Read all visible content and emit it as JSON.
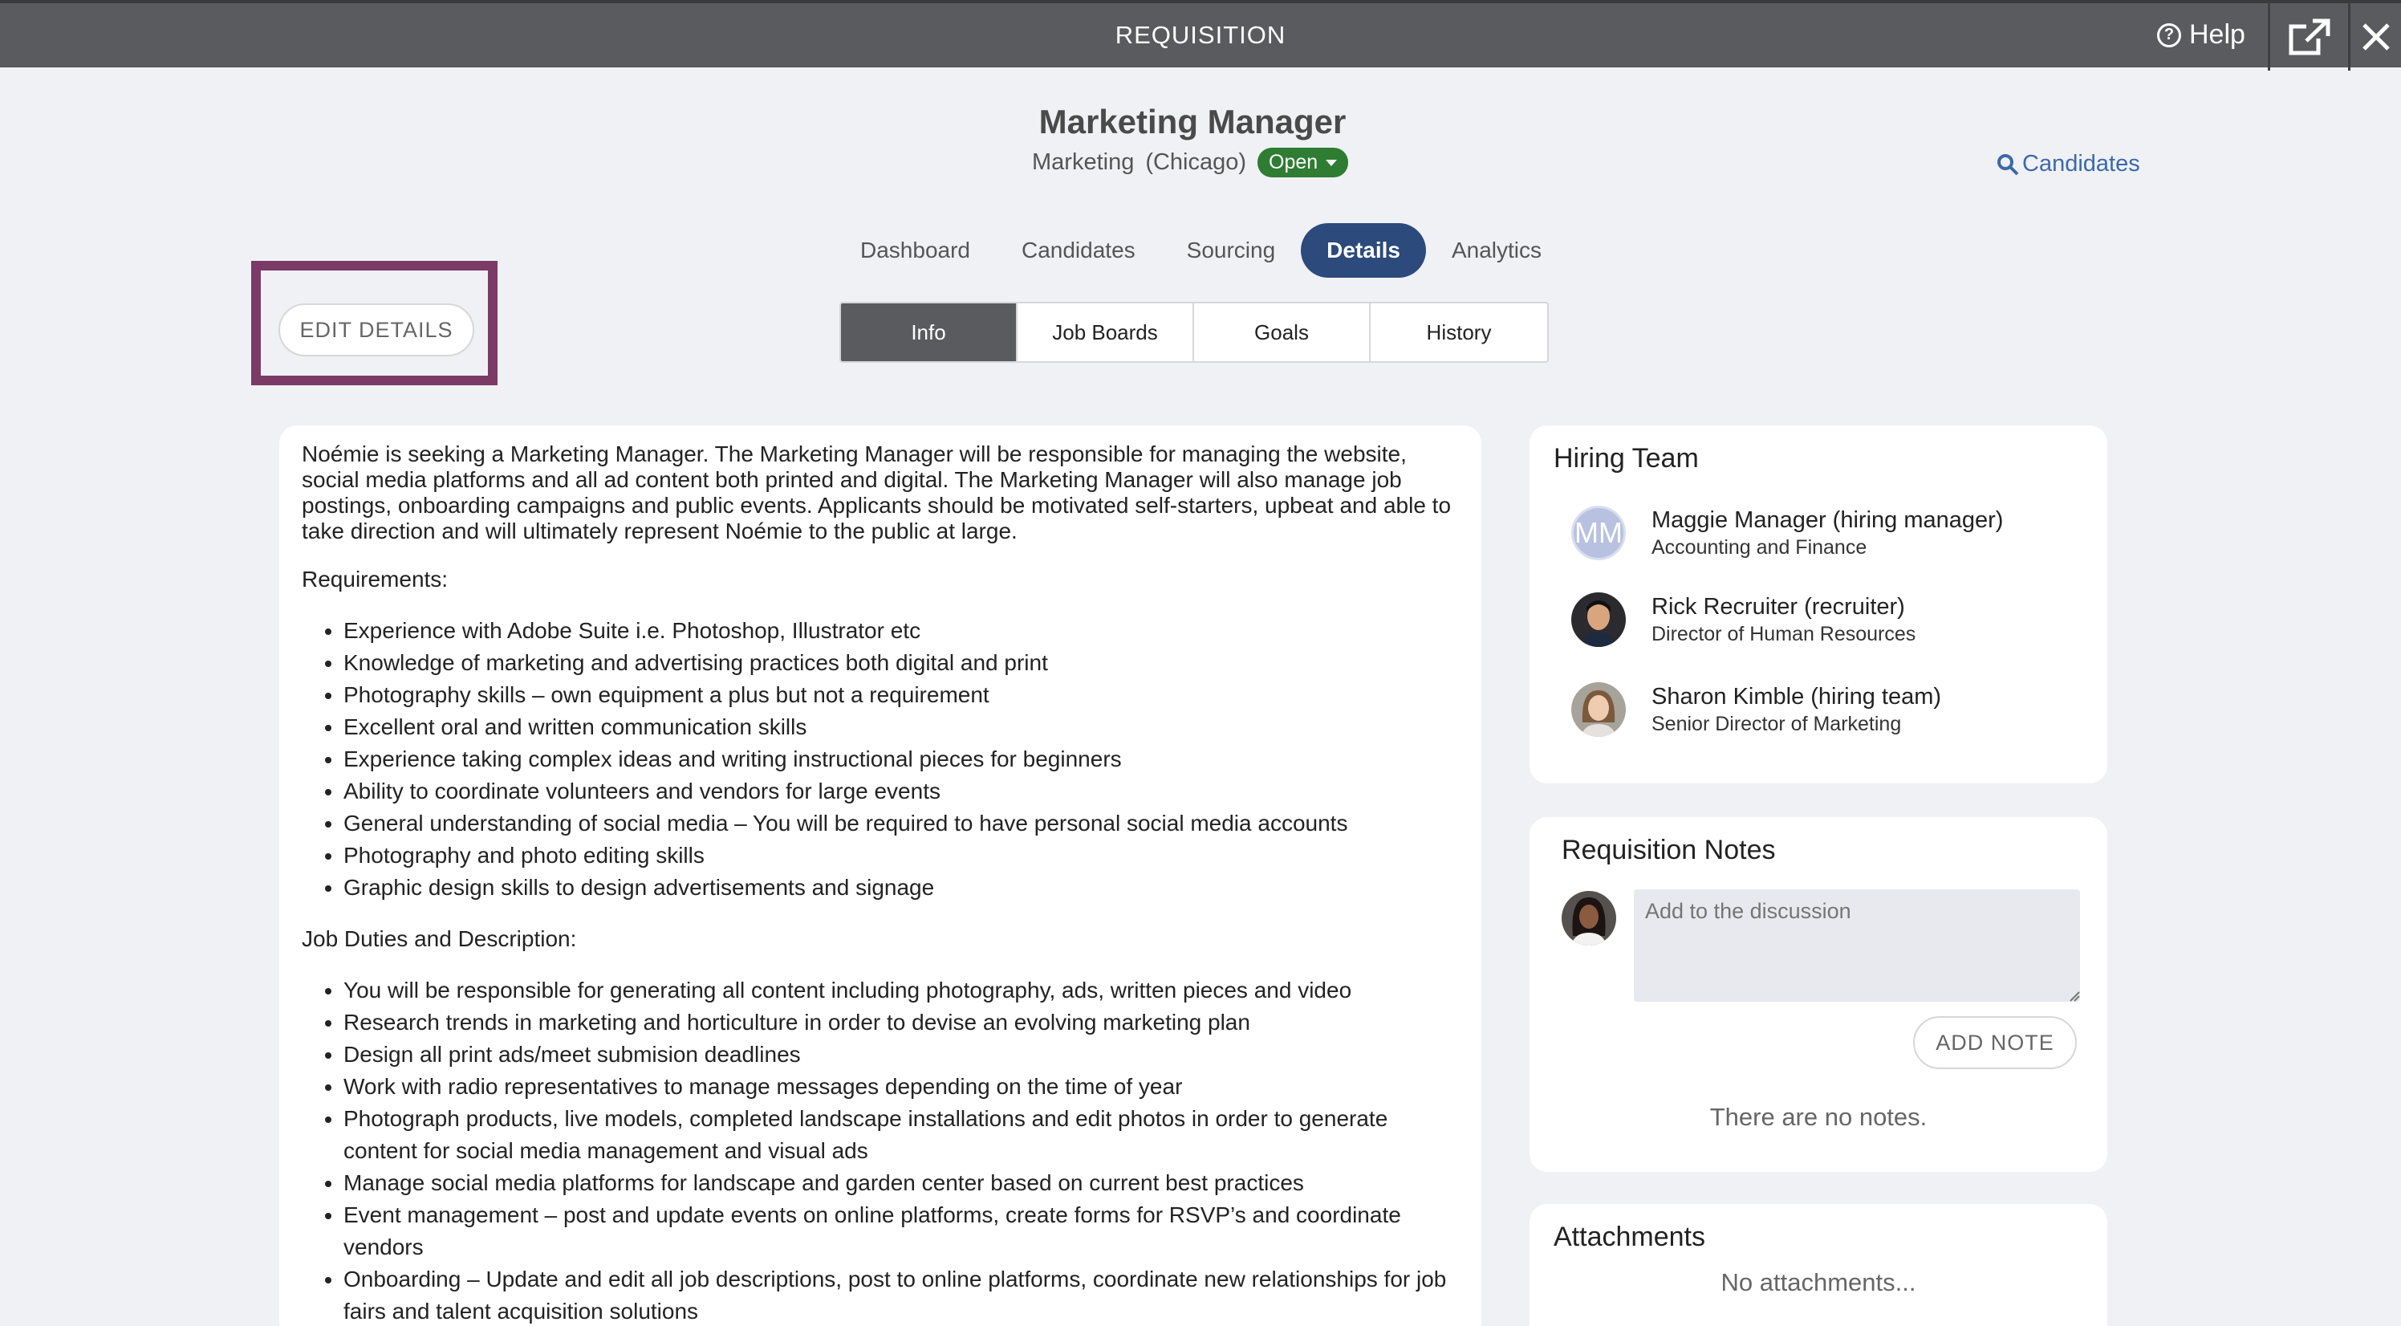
{
  "window": {
    "title": "REQUISITION",
    "help_label": "Help",
    "icons": [
      "help-circle-icon",
      "external-link-icon",
      "close-icon"
    ]
  },
  "header": {
    "job_title": "Marketing Manager",
    "department": "Marketing",
    "location": "(Chicago)",
    "status": "Open",
    "candidates_link": "Candidates"
  },
  "main_tabs": [
    {
      "label": "Dashboard",
      "active": false
    },
    {
      "label": "Candidates",
      "active": false
    },
    {
      "label": "Sourcing",
      "active": false
    },
    {
      "label": "Details",
      "active": true
    },
    {
      "label": "Analytics",
      "active": false
    }
  ],
  "sub_tabs": [
    {
      "label": "Info",
      "active": true
    },
    {
      "label": "Job Boards",
      "active": false
    },
    {
      "label": "Goals",
      "active": false
    },
    {
      "label": "History",
      "active": false
    }
  ],
  "edit_details_label": "EDIT DETAILS",
  "description": {
    "intro": "Noémie is seeking a Marketing Manager. The Marketing Manager will be responsible for managing the website, social media platforms and all ad content both printed and digital. The Marketing Manager will also manage job postings, onboarding campaigns and public events. Applicants should be motivated self-starters, upbeat and able to take direction and will ultimately represent Noémie to the public at large.",
    "requirements_label": "Requirements:",
    "requirements": [
      "Experience with Adobe Suite i.e. Photoshop, Illustrator etc",
      "Knowledge of marketing and advertising practices both digital and print",
      "Photography skills – own equipment a plus but not a requirement",
      "Excellent oral and written communication skills",
      "Experience taking complex ideas and writing instructional pieces for beginners",
      "Ability to coordinate volunteers and vendors for large events",
      "General understanding of social media – You will be required to have personal social media accounts",
      "Photography and photo editing skills",
      "Graphic design skills to design advertisements and signage"
    ],
    "duties_label": "Job Duties and Description:",
    "duties": [
      "You will be responsible for generating all content including photography, ads, written pieces and video",
      "Research trends in marketing and horticulture in order to devise an evolving marketing plan",
      "Design all print ads/meet submision deadlines",
      "Work with radio representatives to manage messages depending on the time of year",
      "Photograph products, live models, completed landscape installations and edit photos in order to generate content for social media management and visual ads",
      "Manage social media platforms for landscape and garden center based on current best practices",
      "Event management – post and update events on online platforms, create forms for RSVP’s and coordinate vendors",
      "Onboarding – Update and edit all job descriptions, post to online platforms, coordinate new relationships for job fairs and talent acquisition solutions"
    ]
  },
  "hiring_team": {
    "title": "Hiring Team",
    "members": [
      {
        "name": "Maggie Manager (hiring manager)",
        "role": "Accounting and Finance",
        "initials": "MM"
      },
      {
        "name": "Rick Recruiter (recruiter)",
        "role": "Director of Human Resources"
      },
      {
        "name": "Sharon Kimble (hiring team)",
        "role": "Senior Director of Marketing"
      }
    ]
  },
  "notes": {
    "title": "Requisition Notes",
    "placeholder": "Add to the discussion",
    "add_label": "ADD NOTE",
    "empty_text": "There are no notes."
  },
  "attachments": {
    "title": "Attachments",
    "empty_text": "No attachments..."
  },
  "colors": {
    "topbar": "#5a5b5e",
    "active_tab": "#2c4a7c",
    "status_green": "#2e7d32",
    "highlight_frame": "#7b3b66",
    "link": "#3b6aa8"
  }
}
